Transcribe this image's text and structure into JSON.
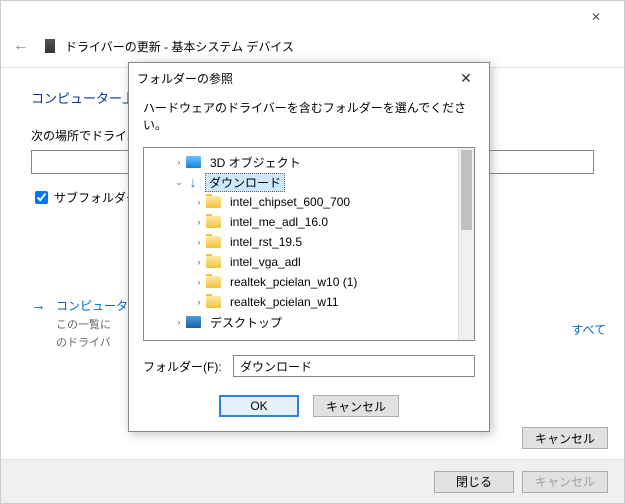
{
  "parent": {
    "title": "ドライバーの更新 - 基本システム デバイス",
    "section": "コンピューター上",
    "location_label": "次の場所でドライバ",
    "subfolders_label": "サブフォルダーも",
    "search_link": "コンピュータ",
    "search_sub1": "この一覧に",
    "search_sub2": "のドライバ",
    "all_link": "すべて",
    "cancel": "キャンセル",
    "close": "閉じる"
  },
  "modal": {
    "title": "フォルダーの参照",
    "instruction": "ハードウェアのドライバーを含むフォルダーを選んでください。",
    "folder_label": "フォルダー(F):",
    "folder_value": "ダウンロード",
    "ok": "OK",
    "cancel": "キャンセル"
  },
  "tree": {
    "items": [
      {
        "label": "3D オブジェクト",
        "expander": ">",
        "indent": 1,
        "icon": "3d"
      },
      {
        "label": "ダウンロード",
        "expander": "v",
        "indent": 1,
        "icon": "dl",
        "selected": true
      },
      {
        "label": "intel_chipset_600_700",
        "expander": ">",
        "indent": 2,
        "icon": "folder"
      },
      {
        "label": "intel_me_adl_16.0",
        "expander": ">",
        "indent": 2,
        "icon": "folder"
      },
      {
        "label": "intel_rst_19.5",
        "expander": ">",
        "indent": 2,
        "icon": "folder"
      },
      {
        "label": "intel_vga_adl",
        "expander": ">",
        "indent": 2,
        "icon": "folder"
      },
      {
        "label": "realtek_pcielan_w10 (1)",
        "expander": ">",
        "indent": 2,
        "icon": "folder"
      },
      {
        "label": "realtek_pcielan_w11",
        "expander": ">",
        "indent": 2,
        "icon": "folder"
      },
      {
        "label": "デスクトップ",
        "expander": ">",
        "indent": 1,
        "icon": "desktop"
      }
    ]
  }
}
